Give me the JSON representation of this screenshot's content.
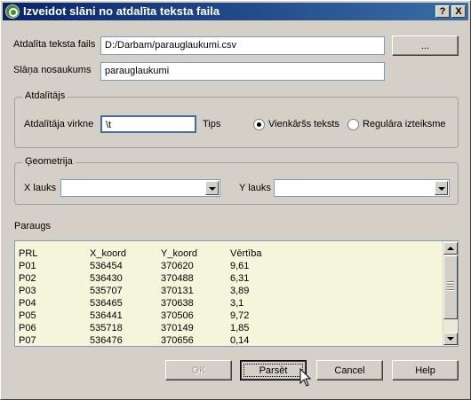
{
  "window": {
    "title": "Izveidot slāni no atdalīta teksta faila",
    "help_btn": "?",
    "close_btn": "X"
  },
  "file": {
    "label": "Atdalīta teksta fails",
    "value": "D:/Darbam/parauglaukumi.csv",
    "browse": "..."
  },
  "layer": {
    "label": "Slāņa nosaukums",
    "value": "parauglaukumi"
  },
  "delimiter": {
    "group": "Atdalītājs",
    "label": "Atdalītāja virkne",
    "value": "\\t",
    "type_label": "Tips",
    "options": [
      {
        "label": "Vienkāršs teksts",
        "checked": true
      },
      {
        "label": "Regulāra izteiksme",
        "checked": false
      }
    ]
  },
  "geometry": {
    "group": "Ģeometrija",
    "x_label": "X lauks",
    "x_value": "",
    "y_label": "Y lauks",
    "y_value": ""
  },
  "sample": {
    "label": "Paraugs",
    "header": [
      "PRL",
      "X_koord",
      "Y_koord",
      "Vērtība"
    ],
    "rows": [
      [
        "P01",
        "536454",
        "370620",
        "9,61"
      ],
      [
        "P02",
        "536430",
        "370488",
        "6,31"
      ],
      [
        "P03",
        "535707",
        "370131",
        "3,89"
      ],
      [
        "P04",
        "536465",
        "370638",
        "3,1"
      ],
      [
        "P05",
        "536441",
        "370506",
        "9,72"
      ],
      [
        "P06",
        "535718",
        "370149",
        "1,85"
      ],
      [
        "P07",
        "536476",
        "370656",
        "0,14"
      ]
    ]
  },
  "buttons": {
    "ok": "OK",
    "parse": "Parsēt",
    "cancel": "Cancel",
    "help": "Help"
  },
  "icons": {
    "app": "qgis-icon",
    "cursor": "mouse-pointer-icon"
  }
}
